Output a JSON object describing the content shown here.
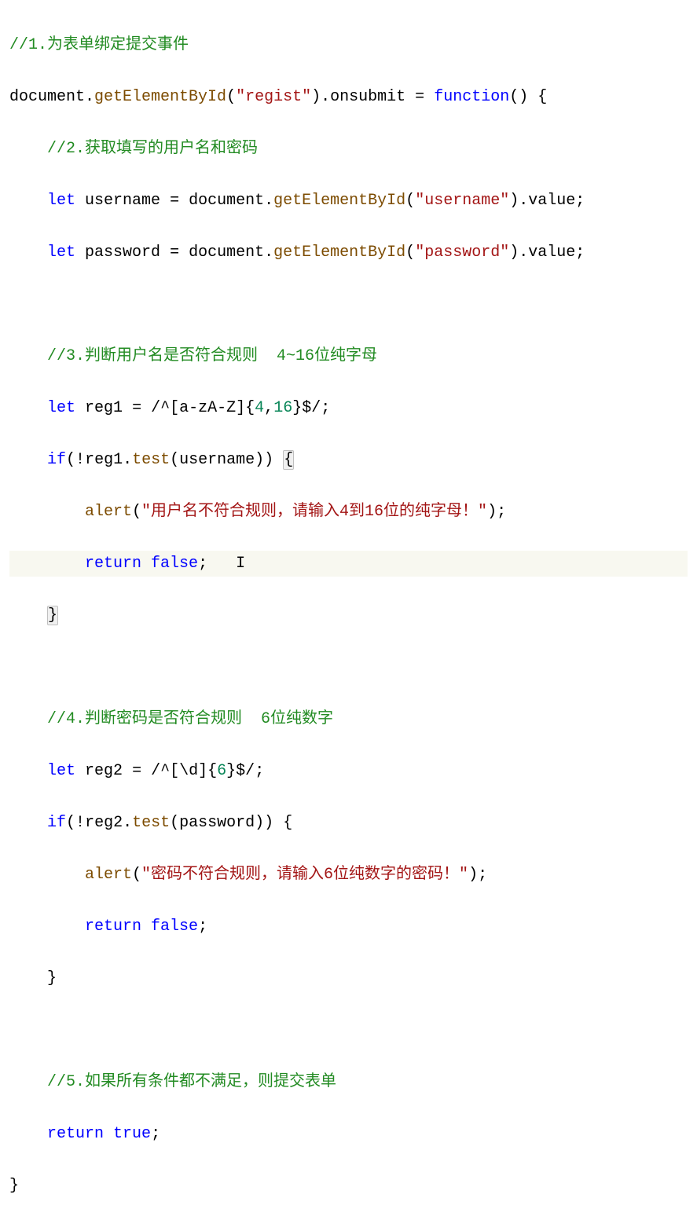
{
  "code": {
    "c1": "//1.为表单绑定提交事件",
    "l2_doc": "document",
    "l2_get": "getElementById",
    "l2_str": "\"regist\"",
    "l2_onsub": "onsubmit",
    "l2_func": "function",
    "c2": "//2.获取填写的用户名和密码",
    "kw_let": "let",
    "v_username": "username",
    "v_password": "password",
    "s_username": "\"username\"",
    "s_password": "\"password\"",
    "p_value": "value",
    "c3a": "//3.判断用户名是否符合规则",
    "c3b": "4~16位纯字母",
    "v_reg1": "reg1",
    "rx1_open": "/^[",
    "rx1_range": "a-zA-Z",
    "rx1_mid": "]{",
    "rx1_n1": "4",
    "rx1_com": ",",
    "rx1_n2": "16",
    "rx1_close": "}$/",
    "kw_if": "if",
    "fn_test": "test",
    "fn_alert": "alert",
    "s_alert1": "\"用户名不符合规则，请输入4到16位的纯字母！\"",
    "kw_return": "return",
    "kw_false": "false",
    "c4a": "//4.判断密码是否符合规则",
    "c4b": "6位纯数字",
    "v_reg2": "reg2",
    "rx2_open": "/^[",
    "rx2_d": "\\d",
    "rx2_mid": "]{",
    "rx2_n": "6",
    "rx2_close": "}$/",
    "s_alert2": "\"密码不符合规则，请输入6位纯数字的密码！\"",
    "c5": "//5.如果所有条件都不满足，则提交表单",
    "kw_true": "true"
  }
}
